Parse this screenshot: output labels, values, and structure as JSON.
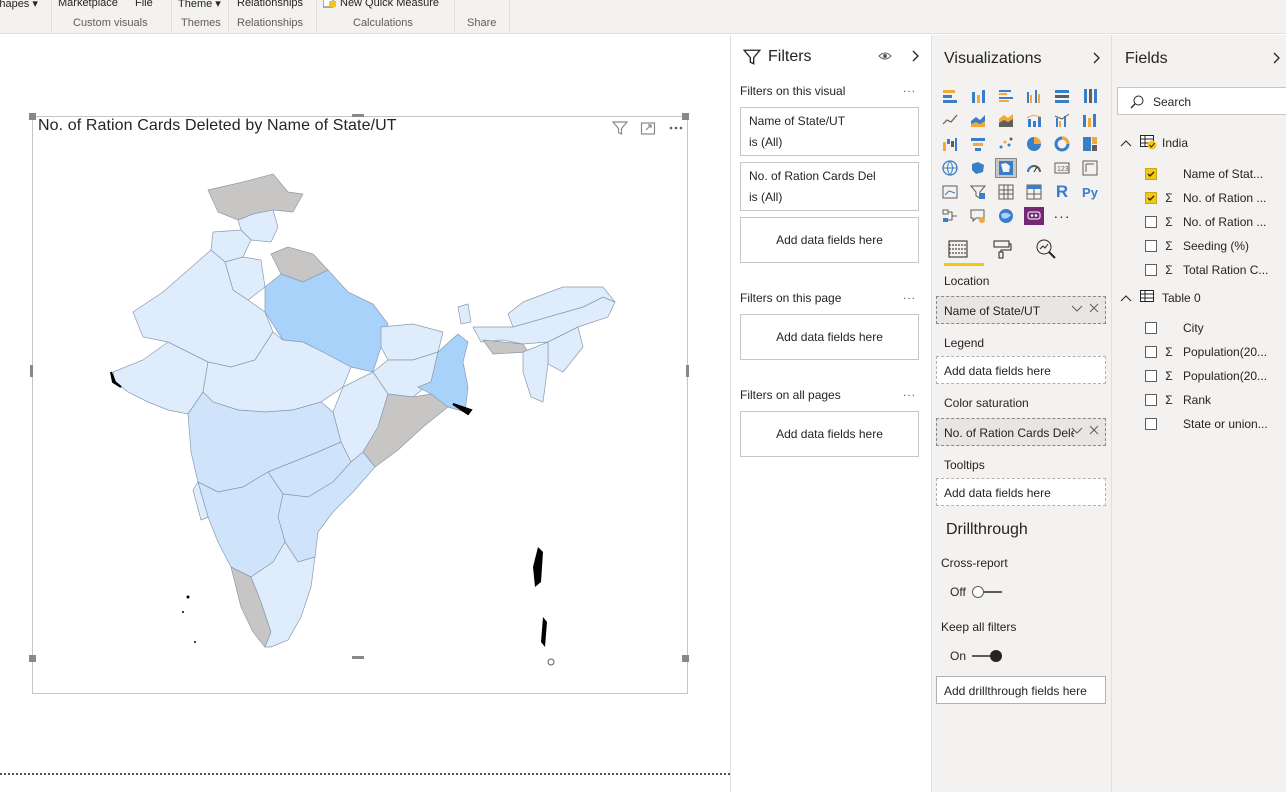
{
  "ribbon": {
    "groups": [
      {
        "top": "Shapes ▾",
        "caption": ""
      },
      {
        "top": "Marketplace",
        "caption": "Custom visuals"
      },
      {
        "top": "File",
        "caption": ""
      },
      {
        "top": "Theme ▾",
        "caption": "Themes"
      },
      {
        "top": "Relationships",
        "caption": "Relationships"
      },
      {
        "top": "New Quick Measure",
        "caption": "Calculations"
      },
      {
        "top": "",
        "caption": "Share"
      }
    ]
  },
  "visual": {
    "title": "No. of Ration Cards Deleted by Name of State/UT",
    "icons": [
      "filter-icon",
      "focus-mode-icon",
      "more-options-icon"
    ],
    "colors": {
      "base": "#deecfb",
      "medium": "#cfe4fb",
      "high": "#a9d2fb",
      "nodata": "#c8c6c4",
      "border": "#8a9bb0"
    }
  },
  "filters": {
    "title": "Filters",
    "on_visual_label": "Filters on this visual",
    "visual_filters": [
      {
        "field": "Name of State/UT",
        "state": "is (All)"
      },
      {
        "field": "No. of Ration Cards Deleted",
        "state": "is (All)"
      }
    ],
    "add_placeholder": "Add data fields here",
    "on_page_label": "Filters on this page",
    "on_all_label": "Filters on all pages",
    "dots": "..."
  },
  "visualizations": {
    "title": "Visualizations",
    "wells": {
      "location_label": "Location",
      "location_value": "Name of State/UT",
      "legend_label": "Legend",
      "legend_placeholder": "Add data fields here",
      "saturation_label": "Color saturation",
      "saturation_value": "No. of Ration Cards Deleted",
      "tooltips_label": "Tooltips",
      "tooltips_placeholder": "Add data fields here"
    },
    "drillthrough": {
      "title": "Drillthrough",
      "cross_report_label": "Cross-report",
      "cross_report_state": "Off",
      "keep_filters_label": "Keep all filters",
      "keep_filters_state": "On",
      "add_placeholder": "Add drillthrough fields here"
    },
    "r_label": "R",
    "py_label": "Py",
    "more": "···"
  },
  "fields": {
    "title": "Fields",
    "search_placeholder": "Search",
    "tables": [
      {
        "name": "India",
        "items": [
          {
            "name": "Name of Stat...",
            "sigma": "",
            "checked": true
          },
          {
            "name": "No. of Ration ...",
            "sigma": "Σ",
            "checked": true
          },
          {
            "name": "No. of Ration ...",
            "sigma": "Σ",
            "checked": false
          },
          {
            "name": "Seeding (%)",
            "sigma": "Σ",
            "checked": false
          },
          {
            "name": "Total Ration C...",
            "sigma": "Σ",
            "checked": false
          }
        ]
      },
      {
        "name": "Table 0",
        "items": [
          {
            "name": "City",
            "sigma": "",
            "checked": false
          },
          {
            "name": "Population(20...",
            "sigma": "Σ",
            "checked": false
          },
          {
            "name": "Population(20...",
            "sigma": "Σ",
            "checked": false
          },
          {
            "name": "Rank",
            "sigma": "Σ",
            "checked": false
          },
          {
            "name": "State or union...",
            "sigma": "",
            "checked": false
          }
        ]
      }
    ]
  }
}
